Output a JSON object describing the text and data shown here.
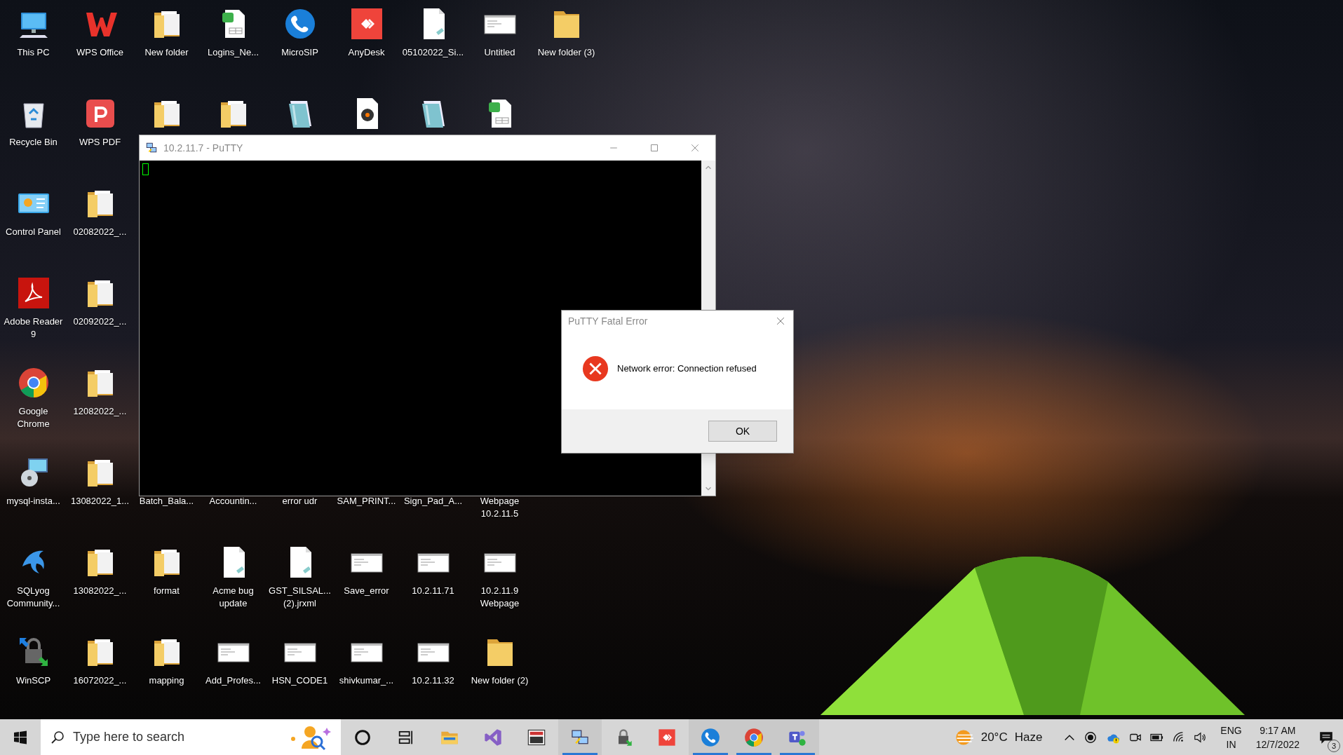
{
  "desktop": {
    "rows": [
      [
        {
          "label": "This PC",
          "kind": "computer"
        },
        {
          "label": "WPS Office",
          "kind": "wps"
        },
        {
          "label": "New folder",
          "kind": "folder"
        },
        {
          "label": "Logins_Ne...",
          "kind": "sheet"
        },
        {
          "label": "MicroSIP",
          "kind": "phone"
        },
        {
          "label": "AnyDesk",
          "kind": "anydesk"
        },
        {
          "label": "05102022_Si...",
          "kind": "document"
        },
        {
          "label": "Untitled",
          "kind": "thumbnail"
        },
        {
          "label": "New folder (3)",
          "kind": "plain_folder"
        }
      ],
      [
        {
          "label": "Recycle Bin",
          "kind": "recycle"
        },
        {
          "label": "WPS PDF",
          "kind": "wpspdf"
        },
        {
          "kind": "folder"
        },
        {
          "kind": "folder"
        },
        {
          "kind": "notepad"
        },
        {
          "kind": "media"
        },
        {
          "kind": "notepad"
        },
        {
          "kind": "sheet"
        }
      ],
      [
        {
          "label": "Control Panel",
          "kind": "control"
        },
        {
          "label": "02082022_...",
          "kind": "folder"
        }
      ],
      [
        {
          "label": "Adobe Reader 9",
          "kind": "pdfreader"
        },
        {
          "label": "02092022_...",
          "kind": "folder"
        }
      ],
      [
        {
          "label": "Google Chrome",
          "kind": "browser"
        },
        {
          "label": "12082022_...",
          "kind": "folder"
        }
      ],
      [
        {
          "label": "mysql-insta...",
          "kind": "installer"
        },
        {
          "label": "13082022_1...",
          "kind": "folder"
        },
        {
          "label": "Batch_Bala..."
        },
        {
          "label": "Accountin..."
        },
        {
          "label": "error udr"
        },
        {
          "label": "SAM_PRINT..."
        },
        {
          "label": "Sign_Pad_A..."
        },
        {
          "label": "Webpage 10.2.11.5"
        }
      ],
      [
        {
          "label": "SQLyog Community...",
          "kind": "dolphin"
        },
        {
          "label": "13082022_...",
          "kind": "folder"
        },
        {
          "label": "format",
          "kind": "folder"
        },
        {
          "label": "Acme bug update",
          "kind": "document"
        },
        {
          "label": "GST_SILSAL... (2).jrxml",
          "kind": "document"
        },
        {
          "label": "Save_error",
          "kind": "thumbnail"
        },
        {
          "label": "10.2.11.71",
          "kind": "thumbnail"
        },
        {
          "label": "10.2.11.9 Webpage",
          "kind": "thumbnail"
        }
      ],
      [
        {
          "label": "WinSCP",
          "kind": "lock"
        },
        {
          "label": "16072022_...",
          "kind": "folder"
        },
        {
          "label": "mapping",
          "kind": "folder"
        },
        {
          "label": "Add_Profes...",
          "kind": "thumbnail"
        },
        {
          "label": "HSN_CODE1",
          "kind": "thumbnail"
        },
        {
          "label": "shivkumar_...",
          "kind": "thumbnail"
        },
        {
          "label": "10.2.11.32",
          "kind": "thumbnail"
        },
        {
          "label": "New folder (2)",
          "kind": "plain_folder"
        }
      ]
    ]
  },
  "putty_window": {
    "title": "10.2.11.7 - PuTTY",
    "active": false
  },
  "error_dialog": {
    "title": "PuTTY Fatal Error",
    "message": "Network error: Connection refused",
    "button": "OK"
  },
  "taskbar": {
    "search": {
      "placeholder": "Type here to search"
    },
    "apps": [
      {
        "kind": "cortana",
        "running": false
      },
      {
        "kind": "taskview",
        "running": false
      },
      {
        "kind": "explorer",
        "running": false
      },
      {
        "kind": "vs",
        "running": false
      },
      {
        "kind": "vnc",
        "running": false
      },
      {
        "kind": "putty",
        "running": true
      },
      {
        "kind": "winscp",
        "running": false
      },
      {
        "kind": "anydesk",
        "running": false
      },
      {
        "kind": "phone",
        "running": true
      },
      {
        "kind": "browser",
        "running": true
      },
      {
        "kind": "teams",
        "running": true
      }
    ],
    "weather": {
      "temperature": "20°C",
      "condition": "Haze"
    },
    "language": {
      "code": "ENG",
      "region": "IN"
    },
    "clock": {
      "time": "9:17 AM",
      "date": "12/7/2022"
    },
    "notifications": {
      "count": "3"
    }
  }
}
